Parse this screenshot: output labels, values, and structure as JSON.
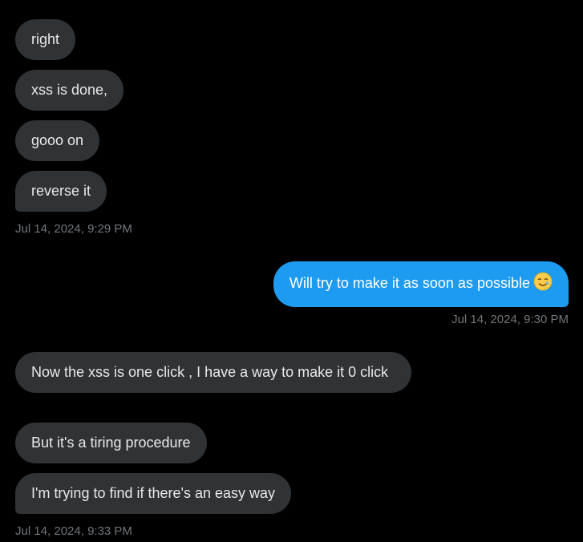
{
  "conversation": {
    "group1": {
      "messages": [
        {
          "text": "right"
        },
        {
          "text": "xss is done,"
        },
        {
          "text": "gooo on"
        },
        {
          "text": "reverse it"
        }
      ],
      "timestamp": "Jul 14, 2024, 9:29 PM"
    },
    "group2": {
      "messages": [
        {
          "text": "Will try to make it as soon as possible",
          "emoji": "smiling-face-with-tear"
        }
      ],
      "timestamp": "Jul 14, 2024, 9:30 PM"
    },
    "group3": {
      "messages": [
        {
          "text": "Now the xss is one click , I have a way to make it 0 click"
        },
        {
          "text": "But it's a tiring procedure"
        },
        {
          "text": "I'm trying to find if there's an easy way"
        }
      ],
      "timestamp": "Jul 14, 2024, 9:33 PM"
    }
  },
  "colors": {
    "background": "#000000",
    "incoming_bubble": "#2f3336",
    "outgoing_bubble": "#1d9bf0",
    "message_text": "#e7e9ea",
    "timestamp_text": "#71767b"
  }
}
